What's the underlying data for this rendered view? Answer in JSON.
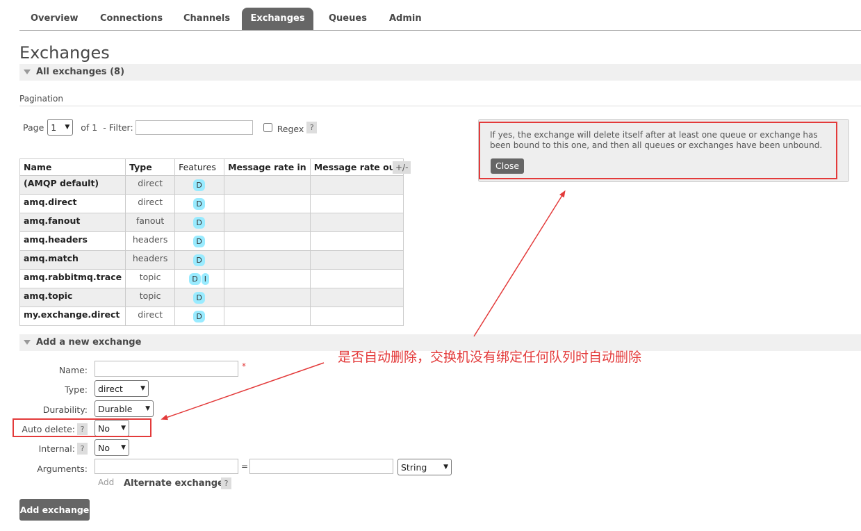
{
  "nav": {
    "tabs": [
      {
        "label": "Overview"
      },
      {
        "label": "Connections"
      },
      {
        "label": "Channels"
      },
      {
        "label": "Exchanges",
        "active": true
      },
      {
        "label": "Queues"
      },
      {
        "label": "Admin"
      }
    ]
  },
  "page": {
    "title": "Exchanges"
  },
  "all_exchanges": {
    "header": "All exchanges (8)"
  },
  "pagination": {
    "label": "Pagination",
    "page_label": "Page",
    "page_value": "1",
    "of_label": "of 1",
    "filter_label": "- Filter:",
    "filter_value": "",
    "regex_label": "Regex",
    "regex_checked": false,
    "help": "?"
  },
  "table": {
    "headers": [
      "Name",
      "Type",
      "Features",
      "Message rate in",
      "Message rate out"
    ],
    "toggle_columns": "+/-",
    "rows": [
      {
        "name": "(AMQP default)",
        "type": "direct",
        "features": [
          "D"
        ]
      },
      {
        "name": "amq.direct",
        "type": "direct",
        "features": [
          "D"
        ]
      },
      {
        "name": "amq.fanout",
        "type": "fanout",
        "features": [
          "D"
        ]
      },
      {
        "name": "amq.headers",
        "type": "headers",
        "features": [
          "D"
        ]
      },
      {
        "name": "amq.match",
        "type": "headers",
        "features": [
          "D"
        ]
      },
      {
        "name": "amq.rabbitmq.trace",
        "type": "topic",
        "features": [
          "D",
          "I"
        ]
      },
      {
        "name": "amq.topic",
        "type": "topic",
        "features": [
          "D"
        ]
      },
      {
        "name": "my.exchange.direct",
        "type": "direct",
        "features": [
          "D"
        ]
      }
    ]
  },
  "help_popup": {
    "text": "If yes, the exchange will delete itself after at least one queue or exchange has been bound to this one, and then all queues or exchanges have been unbound.",
    "close_label": "Close"
  },
  "add_exchange": {
    "header": "Add a new exchange",
    "name_label": "Name:",
    "name_value": "",
    "required_mark": "*",
    "type_label": "Type:",
    "type_value": "direct",
    "durability_label": "Durability:",
    "durability_value": "Durable",
    "auto_delete_label": "Auto delete:",
    "auto_delete_value": "No",
    "internal_label": "Internal:",
    "internal_value": "No",
    "arguments_label": "Arguments:",
    "arguments_key": "",
    "arguments_eq": "=",
    "arguments_value": "",
    "arguments_type": "String",
    "add_link": "Add",
    "alternate_exchange": "Alternate exchange",
    "help": "?",
    "submit_label": "Add exchange"
  },
  "annotation": {
    "text": "是否自动删除，交换机没有绑定任何队列时自动删除",
    "color": "#e33a3a"
  },
  "colors": {
    "active_tab": "#666666",
    "badge": "#99ebff",
    "annotation_red": "#e33a3a"
  }
}
